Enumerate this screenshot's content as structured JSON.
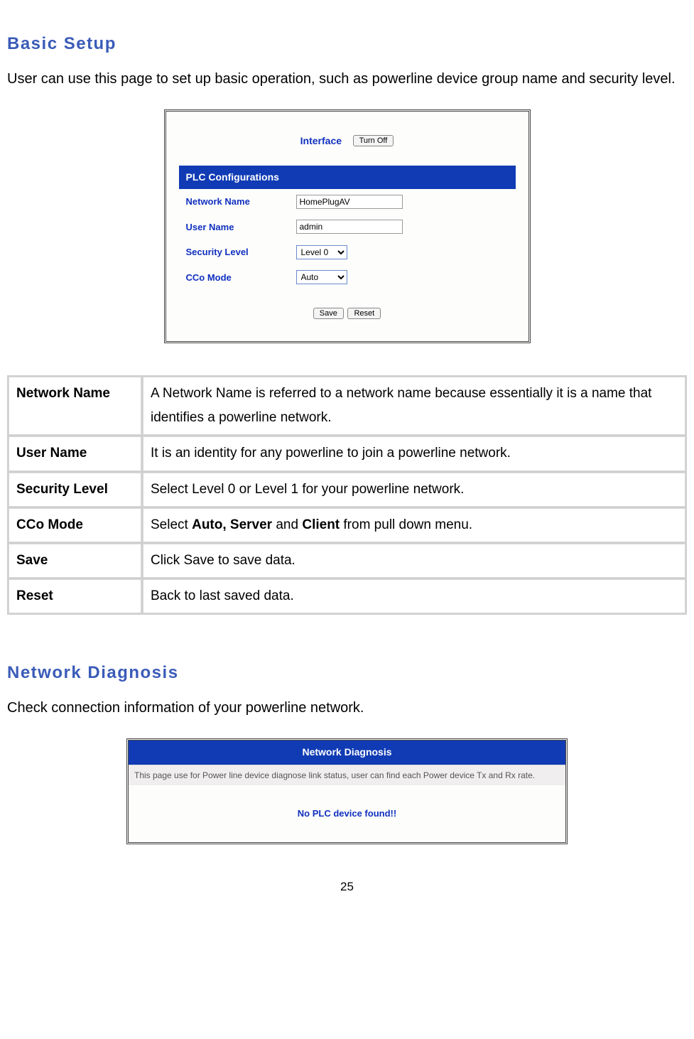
{
  "section1": {
    "title": "Basic Setup",
    "intro": "User can use this page to set up basic operation, such as powerline device group name and security level."
  },
  "setupPanel": {
    "interfaceLabel": "Interface",
    "turnOffButton": "Turn Off",
    "plcConfigHeading": "PLC Configurations",
    "rows": {
      "networkNameLabel": "Network Name",
      "networkNameValue": "HomePlugAV",
      "userNameLabel": "User Name",
      "userNameValue": "admin",
      "securityLevelLabel": "Security Level",
      "securityLevelValue": "Level 0",
      "ccoModeLabel": "CCo Mode",
      "ccoModeValue": "Auto"
    },
    "saveButton": "Save",
    "resetButton": "Reset"
  },
  "descTable": {
    "r0": {
      "k": "Network Name",
      "v": "A Network Name is referred to a network name because essentially it is a name that identifies a powerline network."
    },
    "r1": {
      "k": "User Name",
      "v": "It is an identity for any powerline to join a powerline network."
    },
    "r2": {
      "k": "Security Level",
      "v": "Select Level 0 or Level 1 for your powerline network."
    },
    "r3": {
      "k": "CCo Mode",
      "v_pre": "Select ",
      "v_bold1": "Auto, Server",
      "v_mid": " and ",
      "v_bold2": "Client",
      "v_post": " from pull down menu."
    },
    "r4": {
      "k": "Save",
      "v": "Click Save to save data."
    },
    "r5": {
      "k": "Reset",
      "v": "Back to last saved data."
    }
  },
  "section2": {
    "title": "Network Diagnosis",
    "intro": "Check connection information of your powerline network."
  },
  "diagPanel": {
    "heading": "Network Diagnosis",
    "desc": "This page use for Power line device diagnose link status, user can find each Power device Tx and Rx rate.",
    "empty": "No PLC device found!!"
  },
  "pageNumber": "25"
}
